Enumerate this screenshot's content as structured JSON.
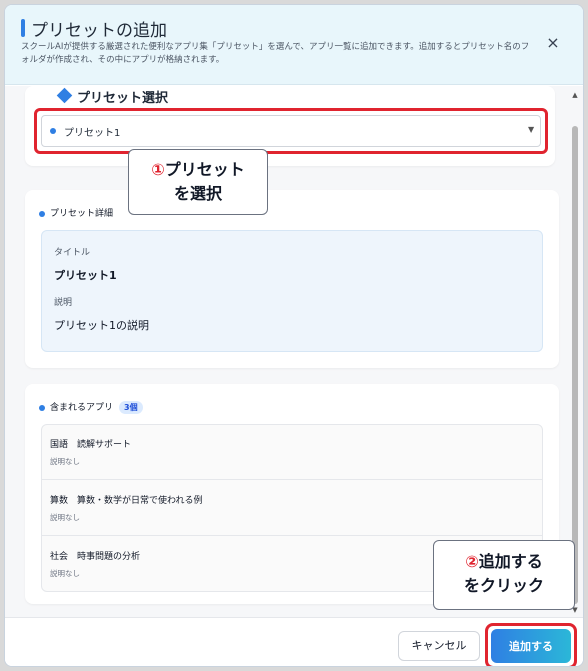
{
  "header": {
    "title": "プリセットの追加",
    "description": "スクールAIが提供する厳選された便利なアプリ集「プリセット」を選んで、アプリ一覧に追加できます。追加するとプリセット名のフォルダが作成され、その中にアプリが格納されます。",
    "close_icon": "×"
  },
  "preset_select": {
    "section_title": "プリセット選択",
    "selected_value": "プリセット1"
  },
  "callouts": {
    "step1_number": "①",
    "step1_text_line1": "プリセット",
    "step1_text_line2": "を選択",
    "step2_number": "②",
    "step2_text_line1": "追加する",
    "step2_text_line2": "をクリック"
  },
  "detail": {
    "heading": "プリセット詳細",
    "title_label": "タイトル",
    "title_value": "プリセット1",
    "desc_label": "説明",
    "desc_value": "プリセット1の説明"
  },
  "apps": {
    "heading": "含まれるアプリ",
    "count_badge": "3個",
    "items": [
      {
        "name": "国語　読解サポート",
        "description": "説明なし"
      },
      {
        "name": "算数　算数・数学が日常で使われる例",
        "description": "説明なし"
      },
      {
        "name": "社会　時事問題の分析",
        "description": "説明なし"
      }
    ]
  },
  "footer": {
    "cancel_label": "キャンセル",
    "add_label": "追加する"
  },
  "colors": {
    "accent": "#2f7fe3",
    "highlight_red": "#e0242f"
  }
}
